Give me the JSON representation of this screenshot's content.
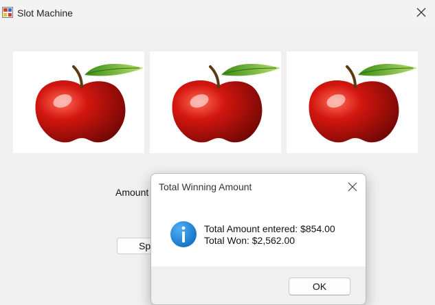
{
  "window": {
    "title": "Slot Machine",
    "close_icon": "close-icon"
  },
  "reels": [
    {
      "symbol": "apple"
    },
    {
      "symbol": "apple"
    },
    {
      "symbol": "apple"
    }
  ],
  "form": {
    "amount_label": "Amount I",
    "spin_label": "Spi"
  },
  "dialog": {
    "title": "Total Winning Amount",
    "icon": "info-icon",
    "line1": "Total Amount entered: $854.00",
    "line2": "Total Won: $2,562.00",
    "ok_label": "OK"
  },
  "colors": {
    "info_blue": "#1a7fd8",
    "apple_red": "#c8130f",
    "leaf_green": "#5fae2a"
  }
}
